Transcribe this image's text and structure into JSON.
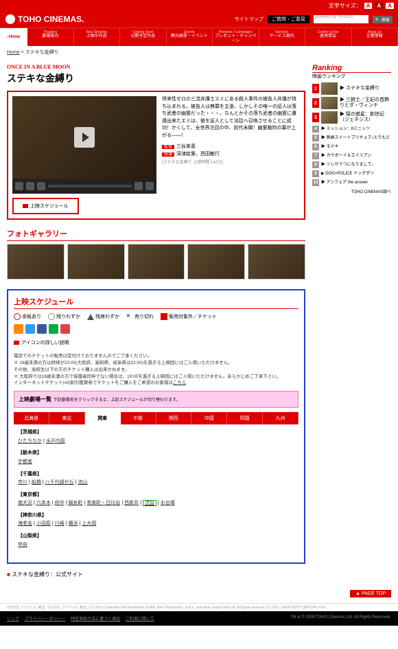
{
  "topbar": {
    "font_size_label": "文字サイズ：",
    "a1": "A",
    "a2": "A",
    "a3": "A"
  },
  "header": {
    "logo": "TOHO CINEMAS.",
    "sitemap": "サイトマップ",
    "inquiry": "ご質問・ご意見",
    "powered": "powered by YAHOO!",
    "search_btn": "検索"
  },
  "nav": {
    "home": "Home",
    "items": [
      {
        "en": "Theaters",
        "ja": "劇場案内"
      },
      {
        "en": "Now Showing",
        "ja": "上映中作品"
      },
      {
        "en": "Coming Soon",
        "ja": "公開予定作品"
      },
      {
        "en": "Events",
        "ja": "舞台挨拶・イベント"
      },
      {
        "en": "Presents / Campaigns",
        "ja": "プレゼント・キャンペーン"
      },
      {
        "en": "Services",
        "ja": "サービス案内"
      },
      {
        "en": "Confirm Order",
        "ja": "座席照会"
      },
      {
        "en": "About Us",
        "ja": "企業情報"
      }
    ]
  },
  "breadcrumb": {
    "home": "Home",
    "current": "ステキな金縛り"
  },
  "movie": {
    "tagline": "ONCE IN A BLUE MOON",
    "title": "ステキな金縛り",
    "synopsis": "将来性ゼロの三流弁護士エミにある殺人事件の被告人弁護が持ち込まれる。被告人は無罪を主張、しかしその唯一の証人は落ち武者の幽霊だった・・・。なんとかその落ち武者の幽霊に遭遇出来たエミは、彼を証人として法廷へ召喚させることに成功！かくして、全世界注目の中、前代未聞！幽霊裁判の幕が上がる――！",
    "director_label": "監督",
    "director": "三谷幸喜",
    "cast_label": "出演",
    "cast": "深津絵里、西田敏行",
    "runtime": "[ステキな金縛り 上映時間:142分]",
    "schedule_btn": "上映スケジュール"
  },
  "gallery": {
    "title": "フォトギャラリー"
  },
  "schedule": {
    "title": "上映スケジュール",
    "legend": {
      "avail_lots": "余裕あり",
      "avail_few": "残りわずか",
      "avail_low": "残席わずか",
      "sold": "売り切れ",
      "window": "販売対象外／チケット",
      "icon_detail": "アイコンの詳しい説明"
    },
    "notice1": "電話でのチケットの販売は受付けておりませんのでご了承ください。",
    "notice2": "※ 18歳未満の方は終映が23:00(大阪府、高知県、岐阜県は22:00)を過ぎる上映回にはご入場いただけません。",
    "notice3": "その他、高校生以下の方のチケット購入は出来かねます。",
    "notice4": "※ 大阪府では16歳未満の方で保護者同伴でない場合は、19:00を過ぎる上映回にはご入場いただけません。あらかじめご了承下さい。",
    "notice5_pre": "インターネットチケット(vit)割引鑑賞券でチケットをご購入をご希望のお客様は",
    "notice5_link": "こちら",
    "list_title": "上映劇場一覧",
    "list_sub": "下記劇場名をクリックすると、上記スケジュールが切り替わります。",
    "regions": [
      "北海道",
      "東北",
      "関東",
      "中部",
      "関西",
      "中国",
      "四国",
      "九州"
    ],
    "prefs": [
      {
        "name": "【茨城県】",
        "theaters": [
          "ひたちなか",
          "水戸内原"
        ]
      },
      {
        "name": "【栃木県】",
        "theaters": [
          "宇都宮"
        ]
      },
      {
        "name": "【千葉県】",
        "theaters": [
          "市川",
          "船橋",
          "八千代緑が丘",
          "流山"
        ]
      },
      {
        "name": "【東京都】",
        "theaters": [
          "南大沢",
          "六本木",
          "府中",
          "錦糸町",
          "有楽町・日比谷",
          "西新井",
          "渋谷",
          "お台場"
        ]
      },
      {
        "name": "【神奈川県】",
        "theaters": [
          "海老名",
          "小田原",
          "川崎",
          "横浜",
          "上大岡"
        ]
      },
      {
        "name": "【山梨県】",
        "theaters": [
          "甲府"
        ]
      }
    ]
  },
  "official": "ステキな金縛り：公式サイト",
  "ranking": {
    "title": "Ranking",
    "sub": "映画ランキング",
    "top3": [
      {
        "n": "1",
        "t": "ステキな金縛り"
      },
      {
        "n": "2",
        "t": "三銃士／王妃の首飾りとダ・ヴィンチ"
      },
      {
        "n": "3",
        "t": "猿の惑星：創世記（ジェネシス）"
      }
    ],
    "rest": [
      {
        "n": "4",
        "t": "ミッション：8ミニッツ"
      },
      {
        "n": "5",
        "t": "映画スイートプリキュア♪とりもど"
      },
      {
        "n": "6",
        "t": "モテキ"
      },
      {
        "n": "7",
        "t": "カウボーイ＆エイリアン"
      },
      {
        "n": "8",
        "t": "ツレがうつになりまして。"
      },
      {
        "n": "9",
        "t": "DOG×POLICE ドッグポリ"
      },
      {
        "n": "10",
        "t": "アンフェア the answer"
      }
    ],
    "more": "TOHO CINEMAS調べ"
  },
  "pagetop": "PAGE TOP",
  "copy": "(C)2011 フジテレビ 東宝／(C)2011 フジテレビ 東宝／(c) 2011 Constantin Film Produktion GmbH, NEF Productions, S.A.S., and New Legacy Film Ltd. All rights reserved./(C) 2011 TWENTIETH CENTURY FOX",
  "footer": {
    "links": [
      "リンク",
      "プライバシーポリシー",
      "特定商取引法に基づく表記",
      "ご利用に際して"
    ],
    "copyright": "TM & © 2009 TOHO Cinemas Ltd. All Rights Reserved."
  }
}
